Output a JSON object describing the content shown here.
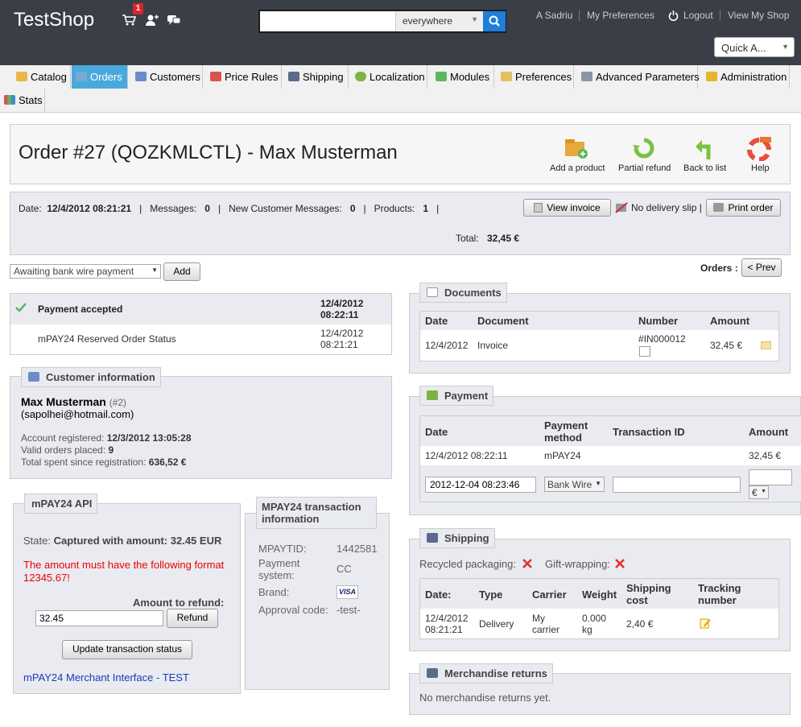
{
  "header": {
    "logo": "TestShop",
    "cart_count": "1",
    "search_scope": "everywhere",
    "links": [
      "A Sadriu",
      "My Preferences",
      "Logout",
      "View My Shop"
    ],
    "quick_access": "Quick A..."
  },
  "tabs": [
    "Catalog",
    "Orders",
    "Customers",
    "Price Rules",
    "Shipping",
    "Localization",
    "Modules",
    "Preferences",
    "Advanced Parameters",
    "Administration",
    "Stats"
  ],
  "title": "Order #27 (QOZKMLCTL) - Max Musterman",
  "toolbar": {
    "add": "Add a product",
    "refund": "Partial refund",
    "back": "Back to list",
    "help": "Help"
  },
  "summary": {
    "date_label": "Date:",
    "date": "12/4/2012 08:21:21",
    "messages_label": "Messages:",
    "messages": "0",
    "new_msgs_label": "New Customer Messages:",
    "new_msgs": "0",
    "products_label": "Products:",
    "products": "1",
    "view_invoice": "View invoice",
    "no_slip": "No delivery slip |",
    "print": "Print order",
    "total_label": "Total:",
    "total": "32,45 €"
  },
  "status": {
    "select": "Awaiting bank wire payment",
    "add": "Add",
    "rows": [
      {
        "label": "Payment accepted",
        "date": "12/4/2012 08:22:11"
      },
      {
        "label": "mPAY24 Reserved Order Status",
        "date": "12/4/2012 08:21:21"
      }
    ]
  },
  "nav": {
    "label": "Orders",
    "prev": "< Prev"
  },
  "customer": {
    "legend": "Customer information",
    "name": "Max Musterman",
    "id": "(#2)",
    "email": "(sapolhei@hotmail.com)",
    "registered_label": "Account registered:",
    "registered": "12/3/2012 13:05:28",
    "valid_label": "Valid orders placed:",
    "valid": "9",
    "spent_label": "Total spent since registration:",
    "spent": "636,52 €"
  },
  "api": {
    "legend": "mPAY24 API",
    "state_label": "State:",
    "state": "Captured with amount: 32.45 EUR",
    "warning": "The amount must have the following format 12345.67!",
    "refund_label": "Amount to refund:",
    "refund_value": "32.45",
    "refund_btn": "Refund",
    "update_btn": "Update transaction status",
    "merchant_link": "mPAY24 Merchant Interface - TEST"
  },
  "tx": {
    "legend": "MPAY24 transaction information",
    "mpaytid_label": "MPAYTID:",
    "mpaytid": "1442581",
    "system_label": "Payment system:",
    "system": "CC",
    "brand_label": "Brand:",
    "brand": "VISA",
    "approval_label": "Approval code:",
    "approval": "-test-"
  },
  "documents": {
    "legend": "Documents",
    "headers": [
      "Date",
      "Document",
      "Number",
      "Amount"
    ],
    "row": {
      "date": "12/4/2012",
      "doc": "Invoice",
      "number": "#IN000012",
      "amount": "32,45 €"
    }
  },
  "payment": {
    "legend": "Payment",
    "headers": [
      "Date",
      "Payment method",
      "Transaction ID",
      "Amount"
    ],
    "row": {
      "date": "12/4/2012 08:22:11",
      "method": "mPAY24",
      "amount": "32,45 €"
    },
    "new_date": "2012-12-04 08:23:46",
    "new_method": "Bank Wire",
    "currency": "€"
  },
  "shipping": {
    "legend": "Shipping",
    "recycled": "Recycled packaging:",
    "gift": "Gift-wrapping:",
    "headers": [
      "Date:",
      "Type",
      "Carrier",
      "Weight",
      "Shipping cost",
      "Tracking number"
    ],
    "row": {
      "date": "12/4/2012 08:21:21",
      "type": "Delivery",
      "carrier": "My carrier",
      "weight": "0.000 kg",
      "cost": "2,40 €"
    }
  },
  "returns": {
    "legend": "Merchandise returns",
    "text": "No merchandise returns yet."
  }
}
